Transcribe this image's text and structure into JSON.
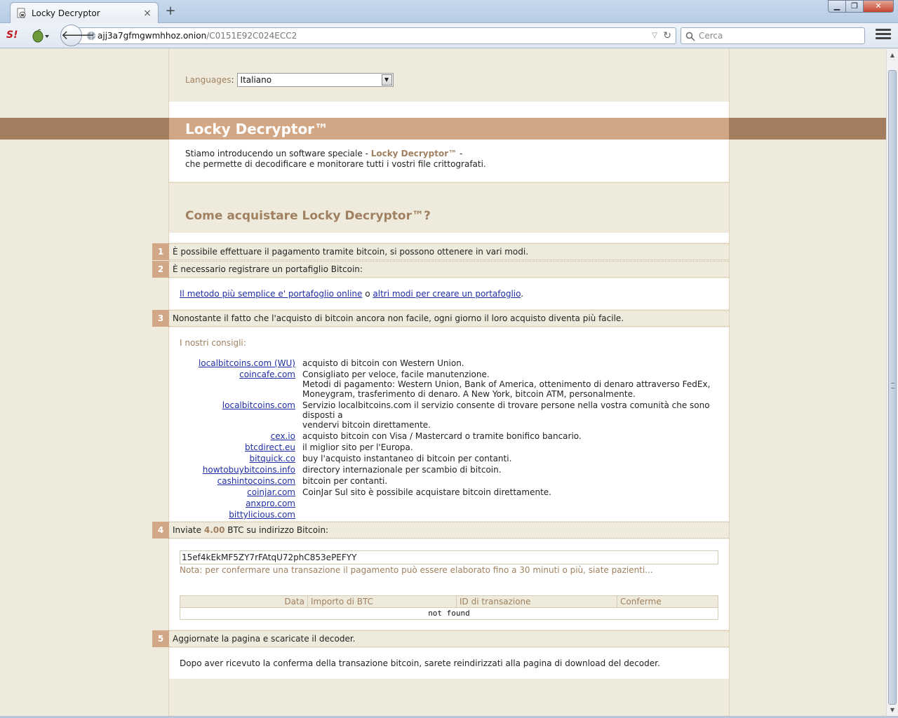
{
  "browser": {
    "tab_title": "Locky Decryptor",
    "new_tab": "+",
    "url_host": "ajj3a7gfmgwmhhoz.onion",
    "url_path": "/C0151E92C024ECC2",
    "search_placeholder": "Cerca",
    "window_buttons": {
      "minimize": "▁",
      "maximize": "❐",
      "close": "✕"
    },
    "s_logo": "S!"
  },
  "language": {
    "label": "Languages",
    "colon": ":",
    "selected": "Italiano"
  },
  "banner": {
    "title": "Locky Decryptor™"
  },
  "intro": {
    "line1_pre": "Stiamo introducendo un software speciale - ",
    "brand": "Locky Decryptor™",
    "line1_post": " -",
    "line2": "che permette di decodificare e monitorare tutti i vostri file crittografati."
  },
  "how_title": "Come acquistare Locky Decryptor™?",
  "steps": [
    {
      "num": "1",
      "text": "È possibile effettuare il pagamento tramite bitcoin, si possono ottenere in vari modi."
    },
    {
      "num": "2",
      "text": "È necessario registrare un portafiglio Bitcoin:"
    },
    {
      "num": "3",
      "text": "Nonostante il fatto che l'acquisto di bitcoin ancora non facile, ogni giorno il loro acquisto diventa più facile."
    },
    {
      "num": "4",
      "text_pre": "Inviate ",
      "amount": "4.00",
      "text_post": " BTC su indirizzo Bitcoin:"
    },
    {
      "num": "5",
      "text": "Aggiornate la pagina e scaricate il decoder."
    }
  ],
  "wallet": {
    "link1": "Il metodo più semplice e' portafoglio online",
    "connector": " o ",
    "link2": "altri modi per creare un portafoglio",
    "end": "."
  },
  "advice_title": "I nostri consigli:",
  "sites": [
    {
      "name": "localbitcoins.com (WU)",
      "desc": "acquisto di bitcoin con Western Union."
    },
    {
      "name": "coincafe.com",
      "desc": "Consigliato per veloce, facile manutenzione.\nMetodi di pagamento: Western Union, Bank of America, ottenimento di denaro attraverso FedEx,\nMoneygram, trasferimento di denaro. A New York, bitcoin ATM, personalmente."
    },
    {
      "name": "localbitcoins.com",
      "desc": "Servizio localbitcoins.com il servizio consente di trovare persone nella vostra comunità che sono disposti a\nvendervi bitcoin direttamente."
    },
    {
      "name": "cex.io",
      "desc": "acquisto bitcoin con Visa / Mastercard o tramite bonifico bancario."
    },
    {
      "name": "btcdirect.eu",
      "desc": "il miglior sito per l'Europa."
    },
    {
      "name": "bitquick.co",
      "desc": "buy l'acquisto instantaneo di bitcoin per contanti."
    },
    {
      "name": "howtobuybitcoins.info",
      "desc": "directory internazionale per scambio di bitcoin."
    },
    {
      "name": "cashintocoins.com",
      "desc": "bitcoin per contanti."
    },
    {
      "name": "coinjar.com",
      "desc": "CoinJar Sul sito è possibile acquistare bitcoin direttamente."
    },
    {
      "name": "anxpro.com",
      "desc": ""
    },
    {
      "name": "bittylicious.com",
      "desc": ""
    }
  ],
  "address": "15ef4kEkMF5ZY7rFAtqU72phC853ePEFYY",
  "note": "Nota: per confermare una transazione il pagamento può essere elaborato fino a 30 minuti o più, siate pazienti...",
  "tx_table": {
    "headers": [
      "Data",
      "Importo di BTC",
      "ID di transazione",
      "Conferme"
    ],
    "empty": "not found"
  },
  "final": "Dopo aver ricevuto la conferma della transazione bitcoin, sarete reindirizzati alla pagina di download del decoder.",
  "colors": {
    "accent": "#a08060",
    "banner_dark": "#a47d5e",
    "banner_light": "#d2a785",
    "page_bg": "#efebdc",
    "link": "#1f2ea3"
  }
}
